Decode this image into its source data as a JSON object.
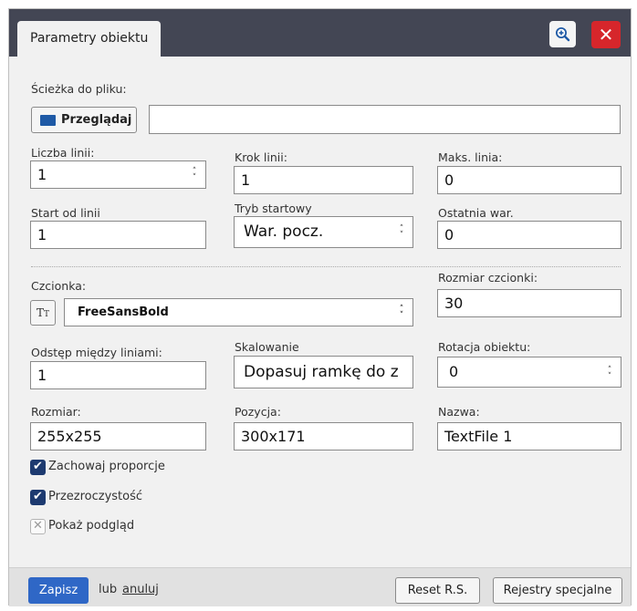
{
  "window": {
    "title": "Parametry obiektu",
    "close_label": "✕"
  },
  "file": {
    "label": "Ścieżka do pliku:",
    "browse_label": "Przeglądaj",
    "path_value": ""
  },
  "lines": {
    "count_label": "Liczba linii:",
    "count_value": "1",
    "step_label": "Krok linii:",
    "step_value": "1",
    "max_label": "Maks. linia:",
    "max_value": "0",
    "start_label": "Start od linii",
    "start_value": "1",
    "mode_label": "Tryb startowy",
    "mode_value": "War. pocz.",
    "last_label": "Ostatnia war.",
    "last_value": "0"
  },
  "font": {
    "label": "Czcionka:",
    "value": "FreeSansBold",
    "size_label": "Rozmiar czcionki:",
    "size_value": "30"
  },
  "layout": {
    "spacing_label": "Odstęp między liniami:",
    "spacing_value": "1",
    "scaling_label": "Skalowanie",
    "scaling_value": "Dopasuj ramkę do z",
    "rotation_label": "Rotacja obiektu:",
    "rotation_value": "0",
    "size_label": "Rozmiar:",
    "size_value": "255x255",
    "position_label": "Pozycja:",
    "position_value": "300x171",
    "name_label": "Nazwa:",
    "name_value": "TextFile 1"
  },
  "options": {
    "keep_ratio": {
      "label": "Zachowaj proporcje",
      "checked": true
    },
    "transparency": {
      "label": "Przezroczystość",
      "checked": true
    },
    "preview": {
      "label": "Pokaż podgląd",
      "checked": false
    }
  },
  "footer": {
    "save_label": "Zapisz",
    "or_label": "lub",
    "cancel_label": "anuluj",
    "reset_label": "Reset R.S.",
    "registers_label": "Rejestry specjalne"
  },
  "colors": {
    "titlebar": "#434654",
    "accent": "#2f67c6",
    "close": "#d6262b",
    "checkbox": "#1d3a70"
  }
}
